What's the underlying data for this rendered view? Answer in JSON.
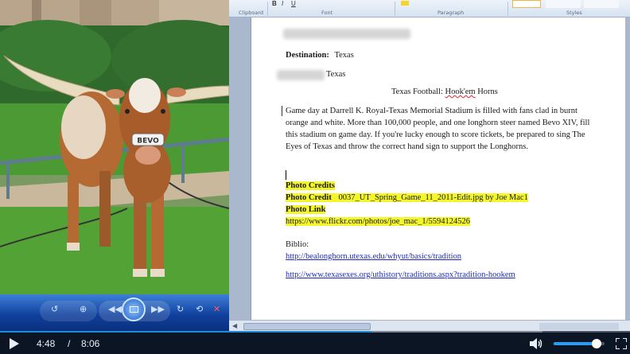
{
  "player": {
    "current_time": "4:48",
    "separator": "/",
    "duration": "8:06",
    "progress_fraction": 0.59,
    "volume_fraction": 0.85,
    "play_icon": "play-icon",
    "volume_icon": "volume-icon",
    "fullscreen_icon": "fullscreen-icon"
  },
  "viewer": {
    "tag_text": "BEVO",
    "controls": [
      "rotate-left-icon",
      "magnifier-icon",
      "prev-icon",
      "slideshow-icon",
      "next-icon",
      "rotate-right-icon",
      "delete-icon"
    ]
  },
  "ribbon": {
    "groups": [
      "Clipboard",
      "Font",
      "Paragraph",
      "Styles"
    ]
  },
  "document": {
    "destination_label": "Destination:",
    "destination_value": "Texas",
    "subtitle_suffix": "Texas",
    "title_prefix": "Texas Football: ",
    "title_squiggle": "Hook'em",
    "title_suffix": " Horns",
    "body_lines": [
      "Game day at Darrell K. Royal-Texas Memorial Stadium is filled with fans clad in burnt",
      "orange and white. More than 100,000 people, and one longhorn steer named Bevo XIV, fill",
      "this stadium on game day. If you're lucky enough to score tickets, be prepared to sing The",
      "Eyes of Texas and throw the correct hand sign to support the Longhorns."
    ],
    "photo_credits_heading": "Photo Credits",
    "photo_credit_label": "Photo Credit",
    "photo_credit_value": "0037_UT_Spring_Game_11_2011-Edit.jpg by Joe Mac1",
    "photo_link_label": "Photo Link",
    "photo_link_url": "https://www.flickr.com/photos/joe_mac_1/5594124526",
    "biblio_label": "Biblio:",
    "biblio_link_1": "http://bealonghorn.utexas.edu/whyut/basics/tradition",
    "biblio_link_2": "http://www.texasexes.org/uthistory/traditions.aspx?tradition-hookem"
  },
  "colors": {
    "highlight": "#f4f62c",
    "link": "#1f2bb8",
    "progress": "#1e8ad8",
    "viewer_bar": "#0f3f9c"
  }
}
